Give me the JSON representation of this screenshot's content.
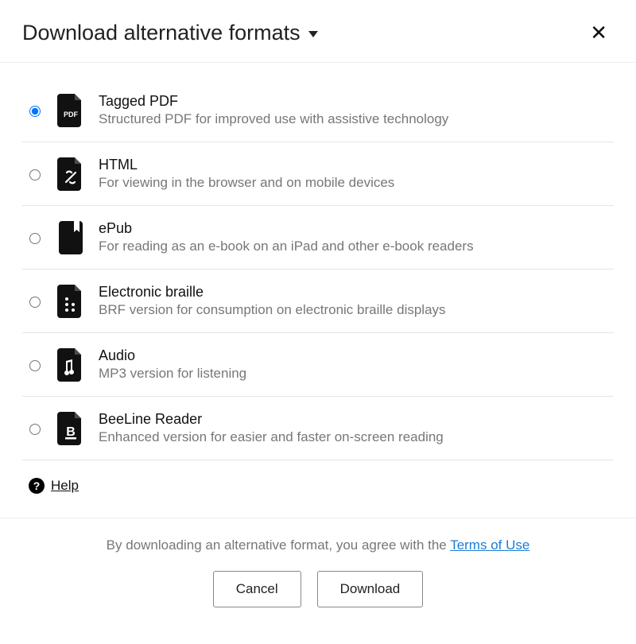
{
  "header": {
    "title": "Download alternative formats"
  },
  "formats": [
    {
      "id": "pdf",
      "title": "Tagged PDF",
      "desc": "Structured PDF for improved use with assistive technology",
      "selected": true
    },
    {
      "id": "html",
      "title": "HTML",
      "desc": "For viewing in the browser and on mobile devices",
      "selected": false
    },
    {
      "id": "epub",
      "title": "ePub",
      "desc": "For reading as an e-book on an iPad and other e-book readers",
      "selected": false
    },
    {
      "id": "braille",
      "title": "Electronic braille",
      "desc": "BRF version for consumption on electronic braille displays",
      "selected": false
    },
    {
      "id": "audio",
      "title": "Audio",
      "desc": "MP3 version for listening",
      "selected": false
    },
    {
      "id": "beeline",
      "title": "BeeLine Reader",
      "desc": "Enhanced version for easier and faster on-screen reading",
      "selected": false
    }
  ],
  "help": {
    "label": "Help"
  },
  "footer": {
    "agree_prefix": "By downloading an alternative format, you agree with the ",
    "terms_label": "Terms of Use",
    "cancel_label": "Cancel",
    "download_label": "Download"
  }
}
